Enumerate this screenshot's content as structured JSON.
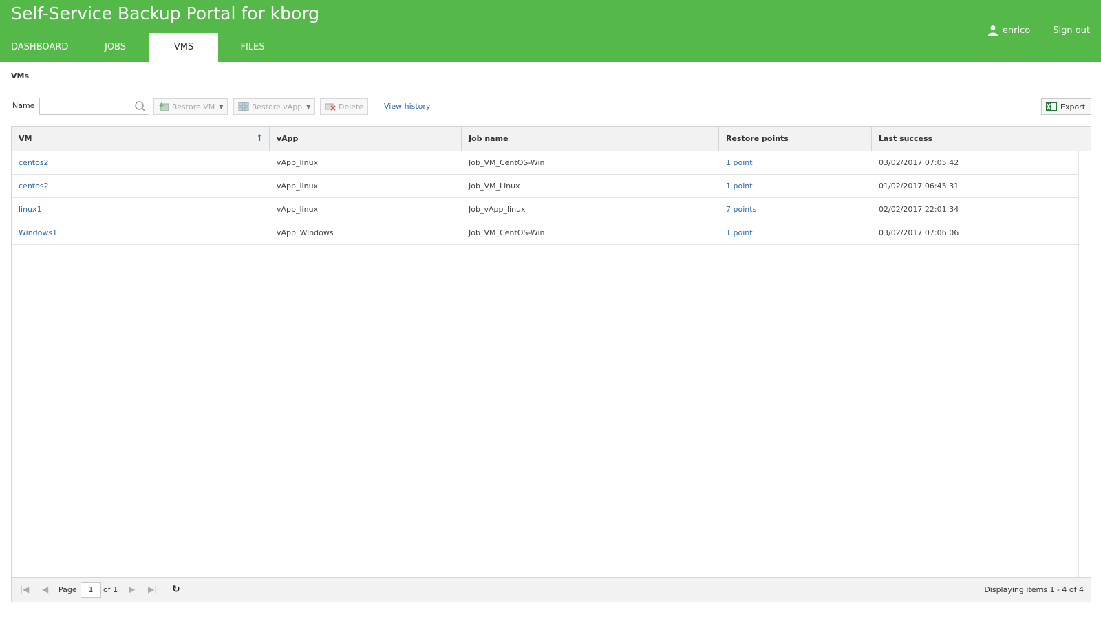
{
  "header": {
    "title": "Self-Service Backup Portal for kborg",
    "tabs": [
      {
        "label": "DASHBOARD"
      },
      {
        "label": "JOBS"
      },
      {
        "label": "VMS"
      },
      {
        "label": "FILES"
      }
    ],
    "active_tab": "VMS",
    "user": "enrico",
    "sign_out": "Sign out"
  },
  "breadcrumb": "VMs",
  "toolbar": {
    "name_label": "Name",
    "search_value": "",
    "restore_vm": "Restore VM",
    "restore_vapp": "Restore vApp",
    "delete": "Delete",
    "view_history": "View history",
    "export": "Export"
  },
  "grid": {
    "columns": [
      "VM",
      "vApp",
      "Job name",
      "Restore points",
      "Last success"
    ],
    "sort_column": "VM",
    "rows": [
      {
        "vm": "centos2",
        "vapp": "vApp_linux",
        "job": "Job_VM_CentOS-Win",
        "points": "1 point",
        "last": "03/02/2017 07:05:42"
      },
      {
        "vm": "centos2",
        "vapp": "vApp_linux",
        "job": "Job_VM_Linux",
        "points": "1 point",
        "last": "01/02/2017 06:45:31"
      },
      {
        "vm": "linux1",
        "vapp": "vApp_linux",
        "job": "Job_vApp_linux",
        "points": "7 points",
        "last": "02/02/2017 22:01:34"
      },
      {
        "vm": "Windows1",
        "vapp": "vApp_Windows",
        "job": "Job_VM_CentOS-Win",
        "points": "1 point",
        "last": "03/02/2017 07:06:06"
      }
    ]
  },
  "pager": {
    "page_label": "Page",
    "page_value": "1",
    "of_label": "of 1",
    "displaying": "Displaying items 1 - 4 of 4"
  },
  "colors": {
    "brand_green": "#54b948",
    "link_blue": "#2a6ab0"
  }
}
